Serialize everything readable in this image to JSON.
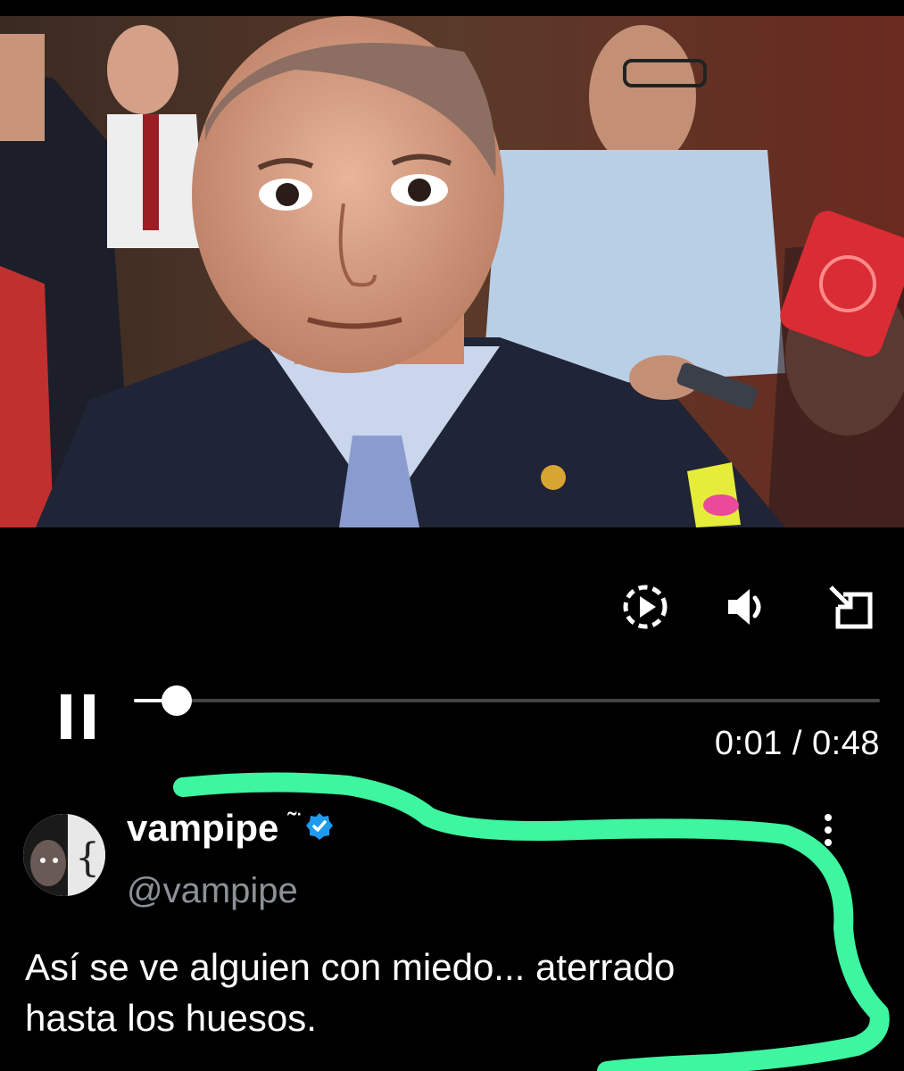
{
  "video": {
    "playback_progress": 0.021,
    "elapsed": "0:01",
    "separator": "/",
    "duration": "0:48",
    "controls": {
      "playback_speed_icon": "playback-speed-icon",
      "volume_icon": "volume-icon",
      "fullscreen_icon": "exit-fullscreen-icon",
      "pause_icon": "pause-icon"
    }
  },
  "tweet": {
    "display_name": "vampipe",
    "name_emoji": "˜̈",
    "verified_icon": "verified-badge-icon",
    "handle": "@vampipe",
    "text_line1": "Así se ve alguien con miedo... aterrado",
    "text_line2": "hasta los huesos.",
    "more_icon": "more-options-icon"
  },
  "colors": {
    "background": "#000000",
    "verified": "#1d9bf0",
    "annotation": "#3ef5a0",
    "progress_fill": "#ffffff",
    "progress_track": "#444444"
  }
}
